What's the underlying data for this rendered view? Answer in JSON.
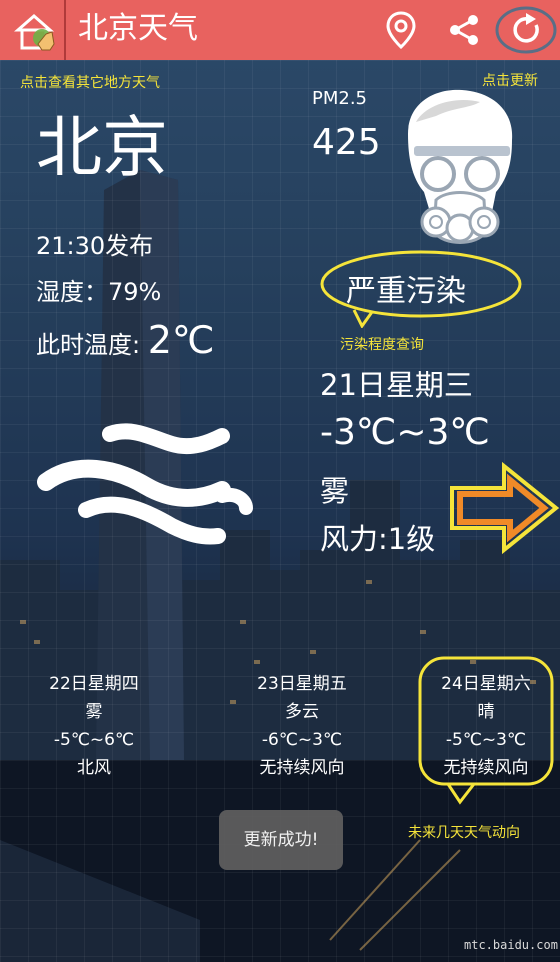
{
  "app": {
    "title": "北京天气"
  },
  "colors": {
    "topbar": "#e8625f",
    "annotation": "#f5e43a",
    "arrow": "#f08a28"
  },
  "icons": {
    "home": "home-icon",
    "location": "location-pin-icon",
    "share": "share-icon",
    "refresh": "refresh-icon",
    "mask": "gas-mask-icon",
    "weather": "fog-icon",
    "arrow": "right-arrow-icon"
  },
  "annotations": {
    "other_cities": "点击查看其它地方天气",
    "refresh_hint": "点击更新",
    "pollution_query": "污染程度查询",
    "forecast_hint": "未来几天天气动向"
  },
  "current": {
    "city": "北京",
    "publish_time": "21:30发布",
    "humidity": "湿度：79%",
    "temp_label": "此时温度:",
    "temp_value": "2℃"
  },
  "air": {
    "pm_label": "PM2.5",
    "pm_value": "425",
    "level": "严重污染"
  },
  "today": {
    "date": "21日星期三",
    "range": "-3℃~3℃",
    "weather": "雾",
    "wind": "风力:1级"
  },
  "forecast": [
    {
      "date": "22日星期四",
      "weather": "雾",
      "range": "-5℃~6℃",
      "wind": "北风"
    },
    {
      "date": "23日星期五",
      "weather": "多云",
      "range": "-6℃~3℃",
      "wind": "无持续风向"
    },
    {
      "date": "24日星期六",
      "weather": "晴",
      "range": "-5℃~3℃",
      "wind": "无持续风向"
    }
  ],
  "toast": "更新成功!",
  "watermark": "mtc.baidu.com"
}
